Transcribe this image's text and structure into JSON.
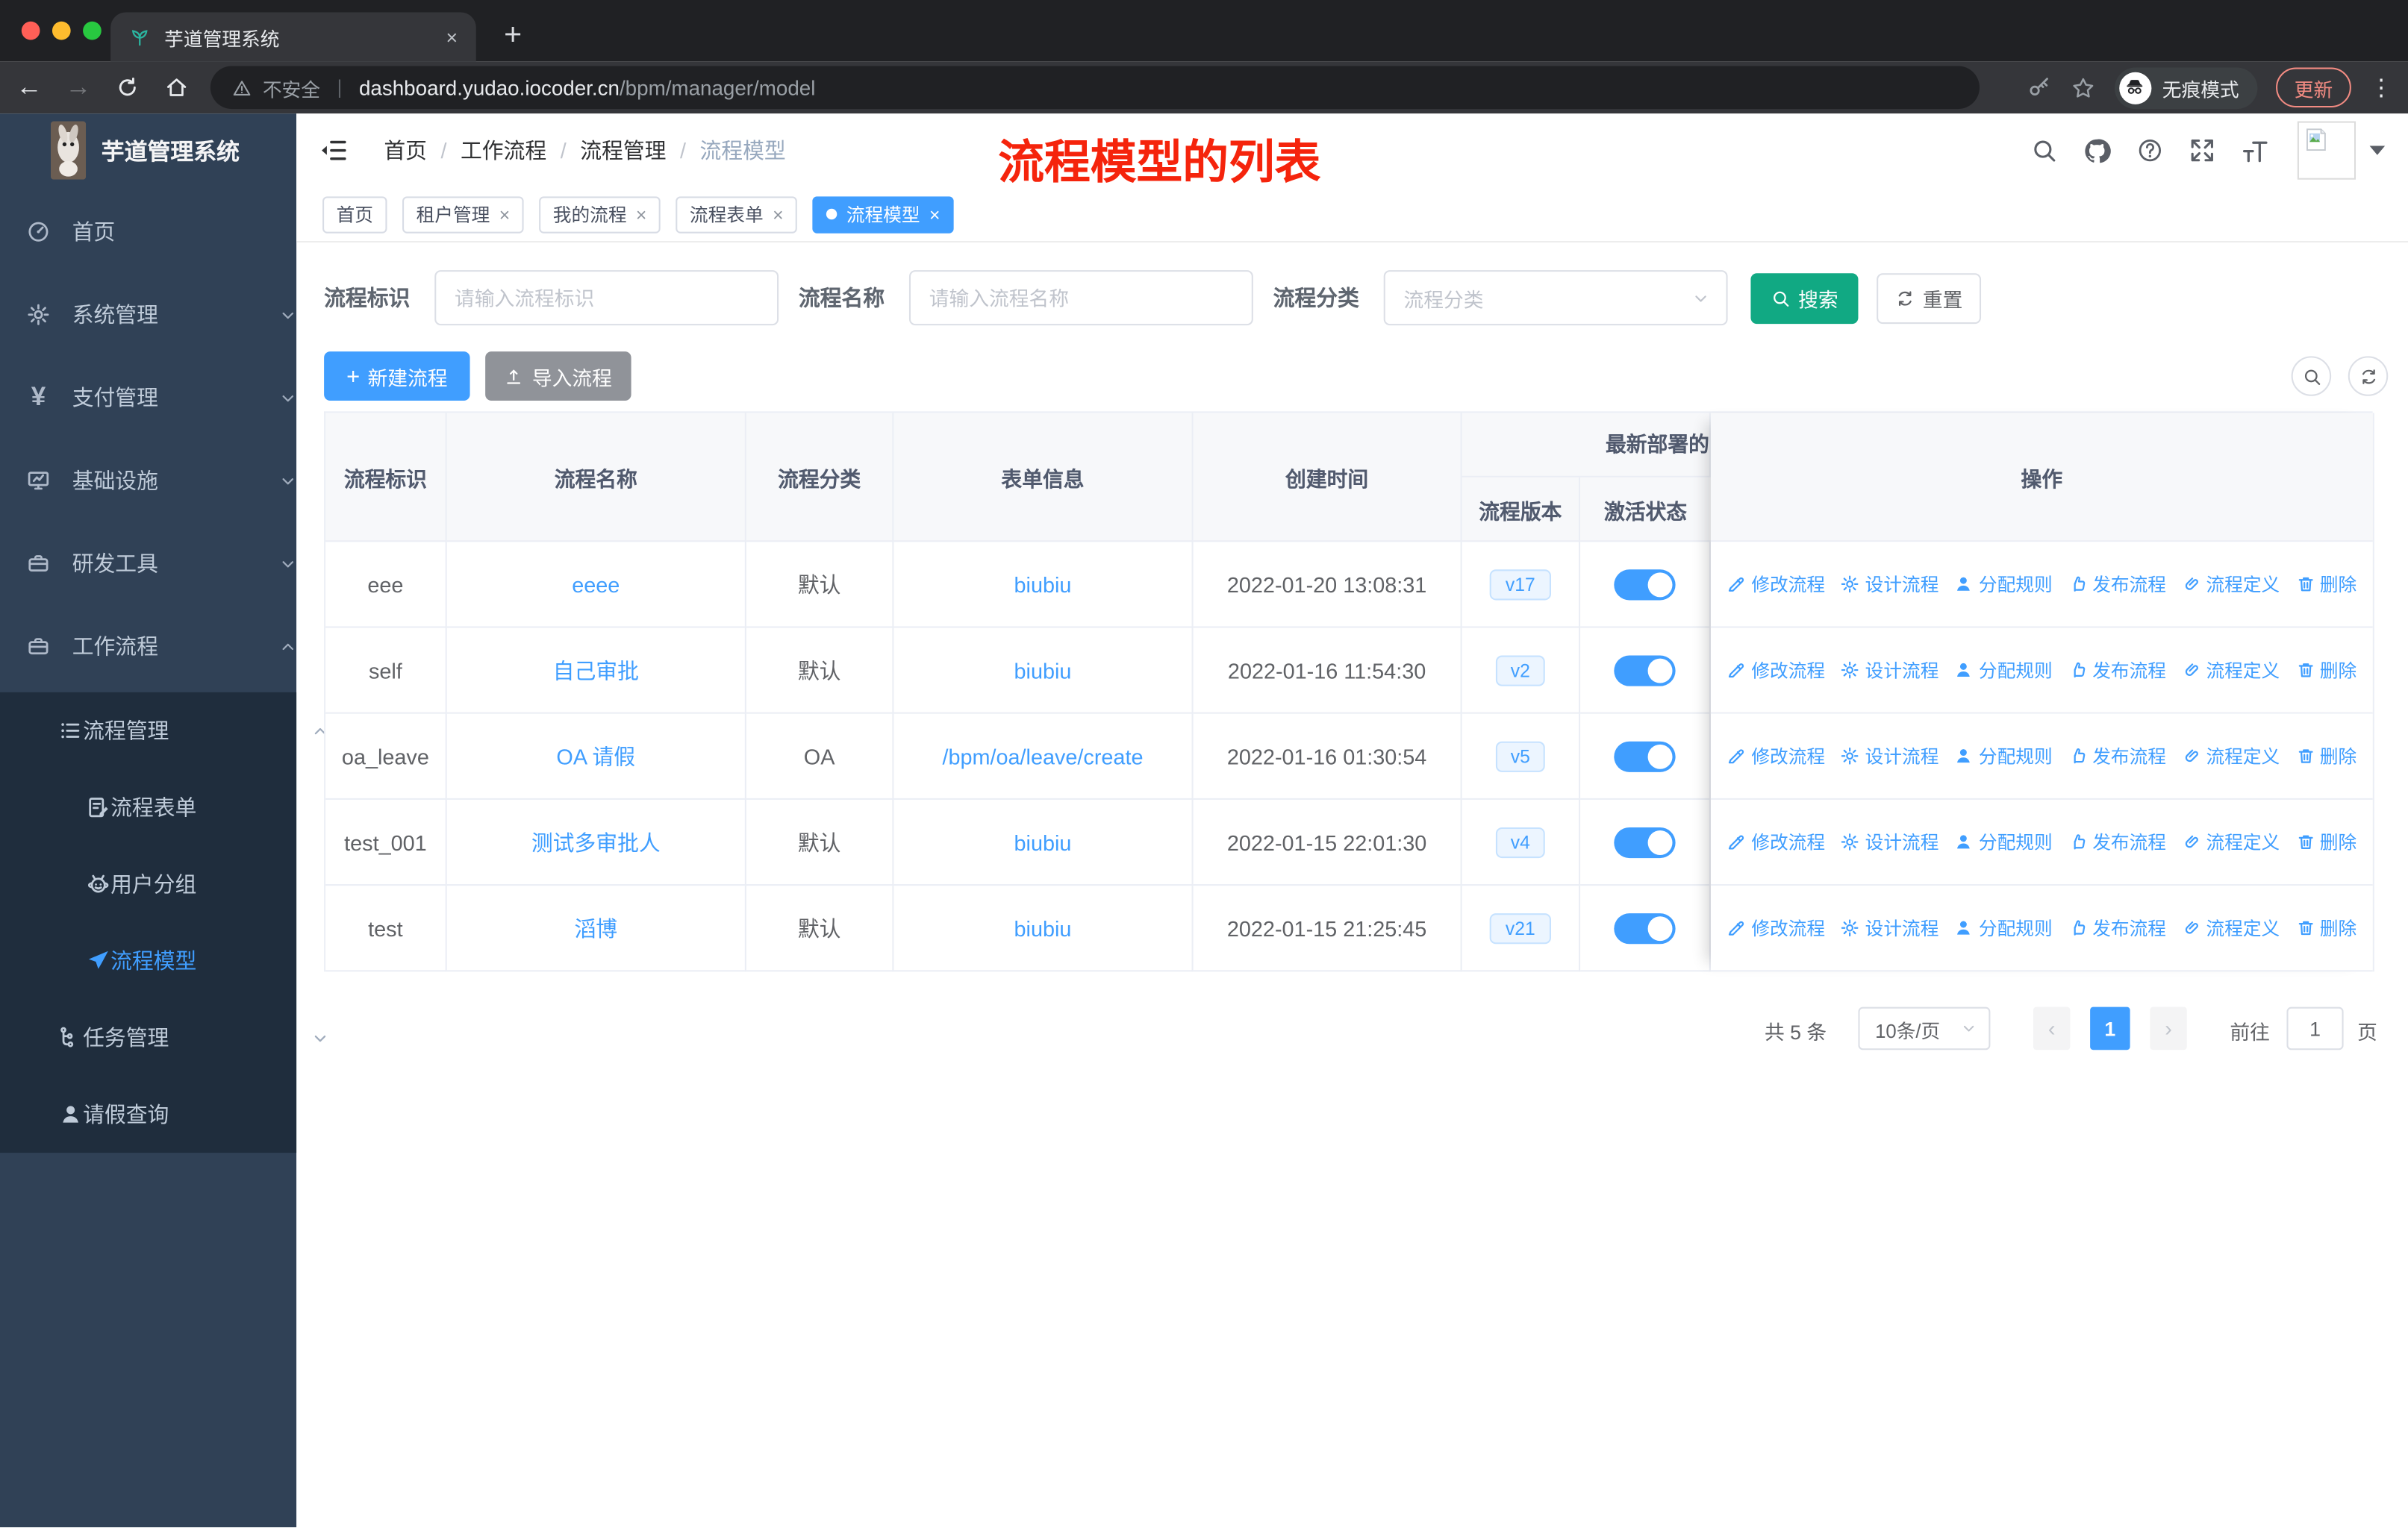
{
  "icons": {
    "close": "×",
    "plus": "+",
    "back": "←",
    "forward": "→",
    "more": "⋮",
    "prev": "‹",
    "next": "›",
    "divider": "/",
    "yen": "¥"
  },
  "browser": {
    "tab_title": "芋道管理系统",
    "security": "不安全",
    "url_host": "dashboard.yudao.iocoder.cn",
    "url_path": "/bpm/manager/model",
    "incognito": "无痕模式",
    "update": "更新"
  },
  "sidebar": {
    "logo_title": "芋道管理系统",
    "items": [
      {
        "label": "首页"
      },
      {
        "label": "系统管理"
      },
      {
        "label": "支付管理"
      },
      {
        "label": "基础设施"
      },
      {
        "label": "研发工具"
      },
      {
        "label": "工作流程"
      },
      {
        "label": "流程管理"
      },
      {
        "label": "流程表单"
      },
      {
        "label": "用户分组"
      },
      {
        "label": "流程模型"
      },
      {
        "label": "任务管理"
      },
      {
        "label": "请假查询"
      }
    ]
  },
  "header": {
    "breadcrumb": [
      "首页",
      "工作流程",
      "流程管理",
      "流程模型"
    ],
    "annotation": "流程模型的列表"
  },
  "tags": [
    "首页",
    "租户管理",
    "我的流程",
    "流程表单",
    "流程模型"
  ],
  "filters": {
    "key_label": "流程标识",
    "key_placeholder": "请输入流程标识",
    "name_label": "流程名称",
    "name_placeholder": "请输入流程名称",
    "category_label": "流程分类",
    "category_placeholder": "流程分类",
    "search": "搜索",
    "reset": "重置"
  },
  "toolbar": {
    "create": "新建流程",
    "import": "导入流程"
  },
  "table": {
    "headers": {
      "key": "流程标识",
      "name": "流程名称",
      "category": "流程分类",
      "form": "表单信息",
      "created": "创建时间",
      "group": "最新部署的",
      "version": "流程版本",
      "status": "激活状态",
      "ops": "操作"
    },
    "rows": [
      {
        "key": "eee",
        "name": "eeee",
        "category": "默认",
        "form": "biubiu",
        "created": "2022-01-20 13:08:31",
        "version": "v17"
      },
      {
        "key": "self",
        "name": "自己审批",
        "category": "默认",
        "form": "biubiu",
        "created": "2022-01-16 11:54:30",
        "version": "v2"
      },
      {
        "key": "oa_leave",
        "name": "OA 请假",
        "category": "OA",
        "form": "/bpm/oa/leave/create",
        "created": "2022-01-16 01:30:54",
        "version": "v5"
      },
      {
        "key": "test_001",
        "name": "测试多审批人",
        "category": "默认",
        "form": "biubiu",
        "created": "2022-01-15 22:01:30",
        "version": "v4"
      },
      {
        "key": "test",
        "name": "滔博",
        "category": "默认",
        "form": "biubiu",
        "created": "2022-01-15 21:25:45",
        "version": "v21"
      }
    ],
    "actions": [
      "修改流程",
      "设计流程",
      "分配规则",
      "发布流程",
      "流程定义",
      "删除"
    ]
  },
  "pagination": {
    "total": "共 5 条",
    "size": "10条/页",
    "page": "1",
    "goto": "前往",
    "unit": "页",
    "value": "1"
  },
  "colors": {
    "primary": "#409eff",
    "search_button": "#11a983",
    "annotation_red": "#f5240c",
    "sidebar_bg": "#304156",
    "submenu_bg": "#1f2d3d"
  }
}
